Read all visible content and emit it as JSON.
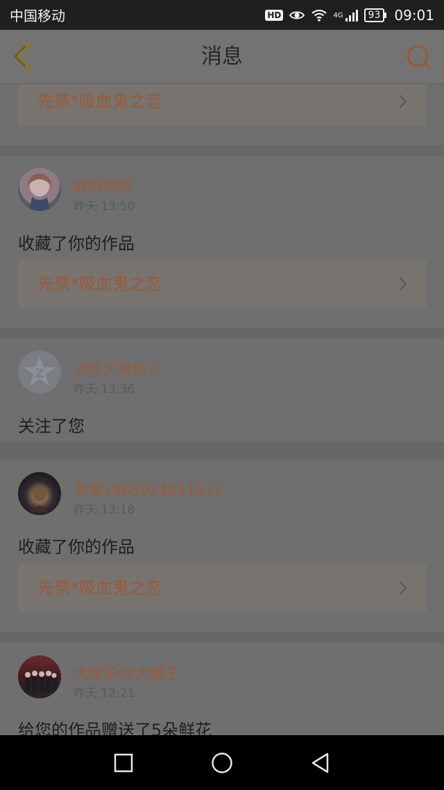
{
  "status_bar": {
    "carrier": "中国移动",
    "hd": "HD",
    "network": "4G",
    "battery": "93",
    "time": "09:01"
  },
  "nav": {
    "title": "消息",
    "back_icon": "chevron-left-icon",
    "search_icon": "search-icon"
  },
  "colors": {
    "accent": "#9b5a34",
    "overlay_bg": "#6f6f6f"
  },
  "messages": [
    {
      "work_title": "先祭*吸血鬼之恋"
    },
    {
      "username": "欧阳岚熙",
      "time": "昨天 13:50",
      "action": "收藏了你的作品",
      "work_title": "先祭*吸血鬼之恋"
    },
    {
      "username": "流年〆易伤ジ",
      "time": "昨天 13:36",
      "action": "关注了您"
    },
    {
      "username": "游客1565924251571",
      "time": "昨天 13:18",
      "action": "收藏了你的作品",
      "work_title": "先祭*吸血鬼之恋"
    },
    {
      "username": "大橙子de大橘子",
      "time": "昨天 12:21",
      "action": "给您的作品赠送了5朵鲜花"
    }
  ],
  "system_nav": {
    "recent": "square-icon",
    "home": "circle-icon",
    "back": "triangle-back-icon"
  }
}
